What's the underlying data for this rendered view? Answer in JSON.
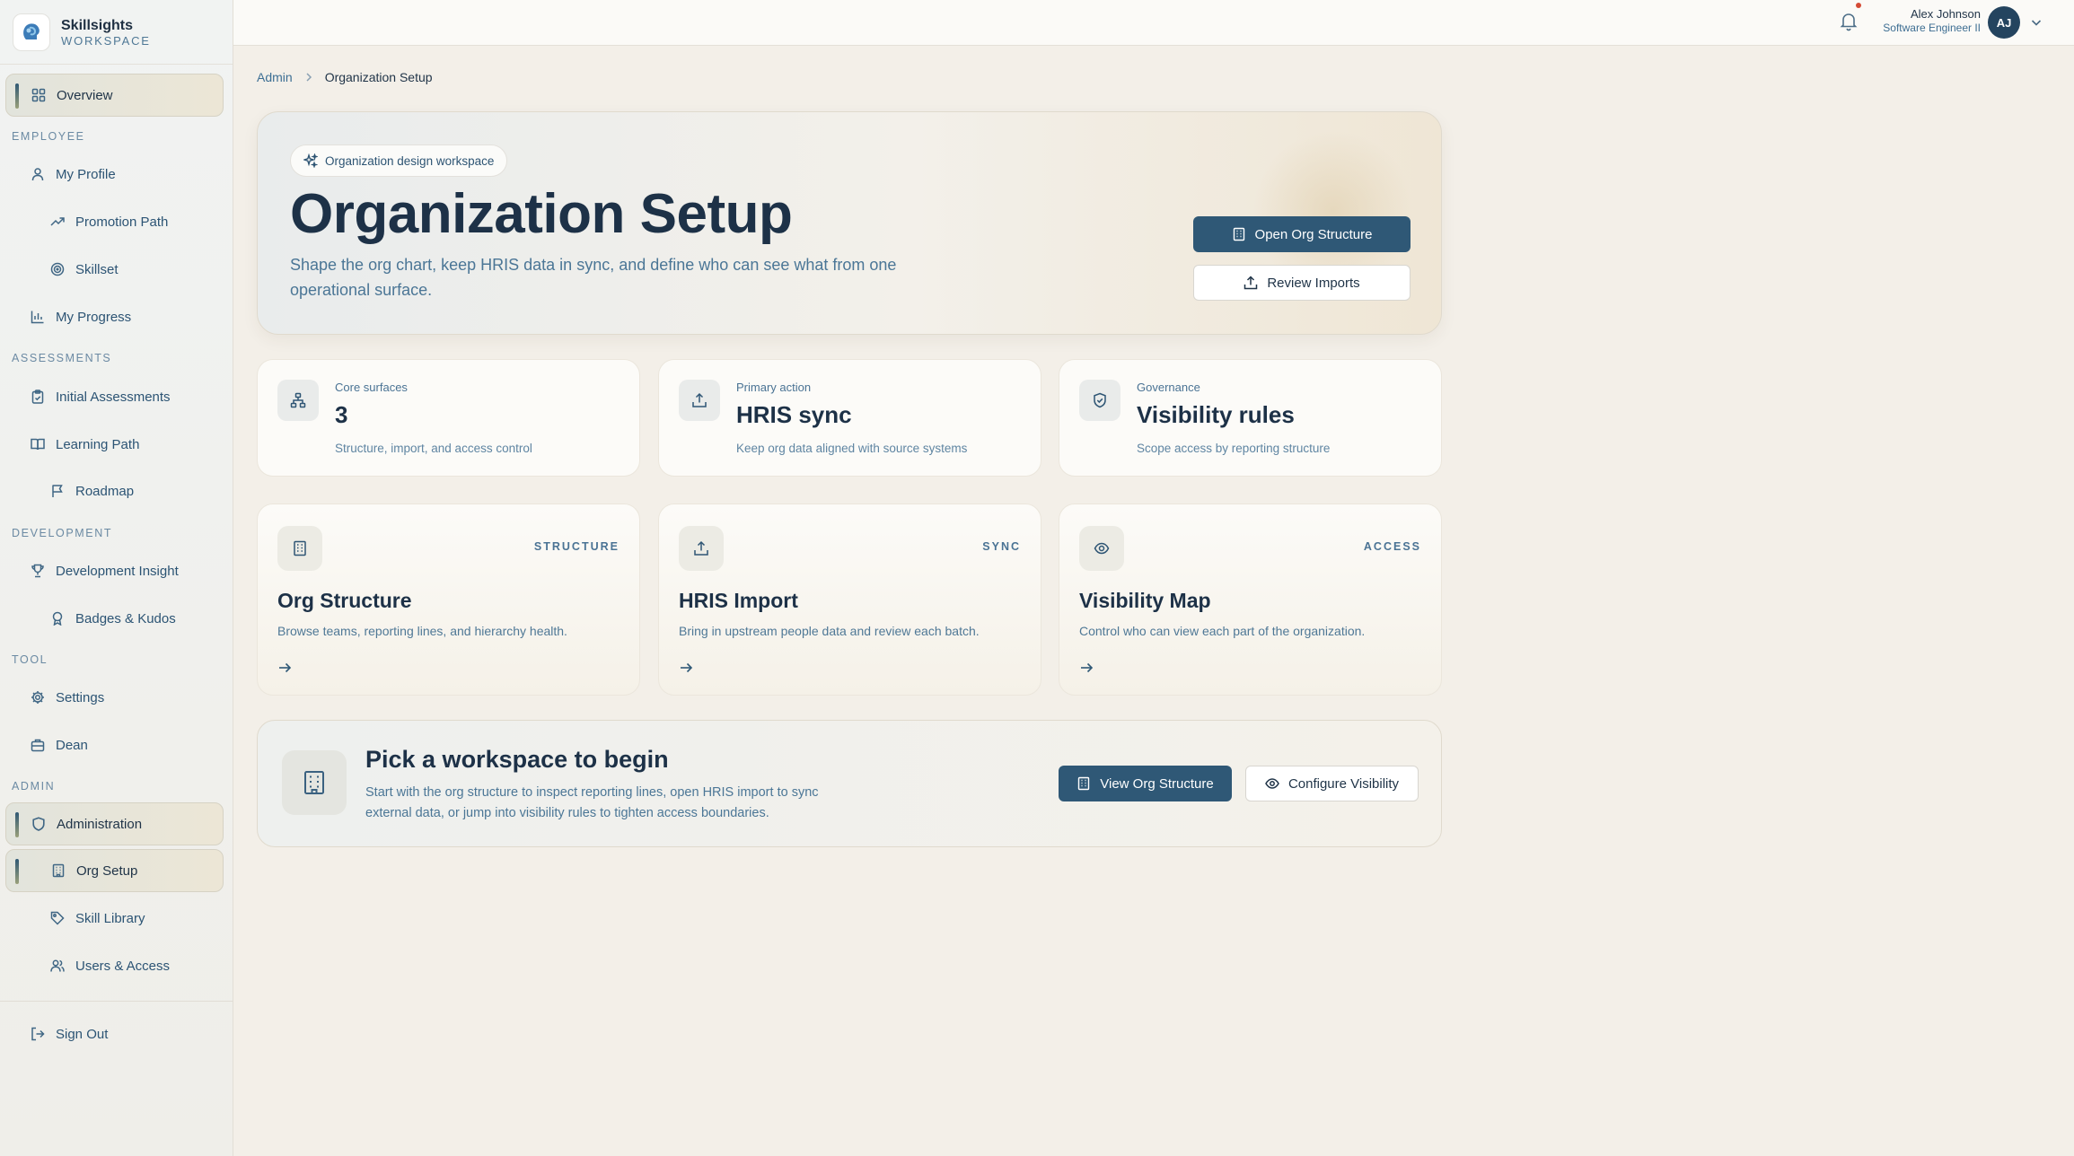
{
  "brand": {
    "name": "Skillsights",
    "sub": "WORKSPACE"
  },
  "nav": {
    "overview": "Overview",
    "sections": {
      "employee": "EMPLOYEE",
      "assessments": "ASSESSMENTS",
      "development": "DEVELOPMENT",
      "tool": "TOOL",
      "admin": "ADMIN"
    },
    "items": {
      "my_profile": "My Profile",
      "promotion_path": "Promotion Path",
      "skillset": "Skillset",
      "my_progress": "My Progress",
      "initial_assessments": "Initial Assessments",
      "learning_path": "Learning Path",
      "roadmap": "Roadmap",
      "development_insight": "Development Insight",
      "badges_kudos": "Badges & Kudos",
      "settings": "Settings",
      "dean": "Dean",
      "administration": "Administration",
      "org_setup": "Org Setup",
      "skill_library": "Skill Library",
      "users_access": "Users & Access",
      "sign_out": "Sign Out"
    }
  },
  "user": {
    "name": "Alex Johnson",
    "role": "Software Engineer II",
    "initials": "AJ"
  },
  "breadcrumb": {
    "parent": "Admin",
    "current": "Organization Setup"
  },
  "hero": {
    "pill": "Organization design workspace",
    "title": "Organization Setup",
    "description": "Shape the org chart, keep HRIS data in sync, and define who can see what from one operational surface.",
    "primary_button": "Open Org Structure",
    "secondary_button": "Review Imports"
  },
  "stats": [
    {
      "label": "Core surfaces",
      "value": "3",
      "desc": "Structure, import, and access control"
    },
    {
      "label": "Primary action",
      "value": "HRIS sync",
      "desc": "Keep org data aligned with source systems"
    },
    {
      "label": "Governance",
      "value": "Visibility rules",
      "desc": "Scope access by reporting structure"
    }
  ],
  "features": [
    {
      "tag": "STRUCTURE",
      "title": "Org Structure",
      "desc": "Browse teams, reporting lines, and hierarchy health."
    },
    {
      "tag": "SYNC",
      "title": "HRIS Import",
      "desc": "Bring in upstream people data and review each batch."
    },
    {
      "tag": "ACCESS",
      "title": "Visibility Map",
      "desc": "Control who can view each part of the organization."
    }
  ],
  "cta": {
    "title": "Pick a workspace to begin",
    "description": "Start with the org structure to inspect reporting lines, open HRIS import to sync external data, or jump into visibility rules to tighten access boundaries.",
    "primary_button": "View Org Structure",
    "secondary_button": "Configure Visibility"
  },
  "colors": {
    "accent": "#2f5876",
    "background": "#f3efe8",
    "notification_dot": "#d44a35"
  }
}
